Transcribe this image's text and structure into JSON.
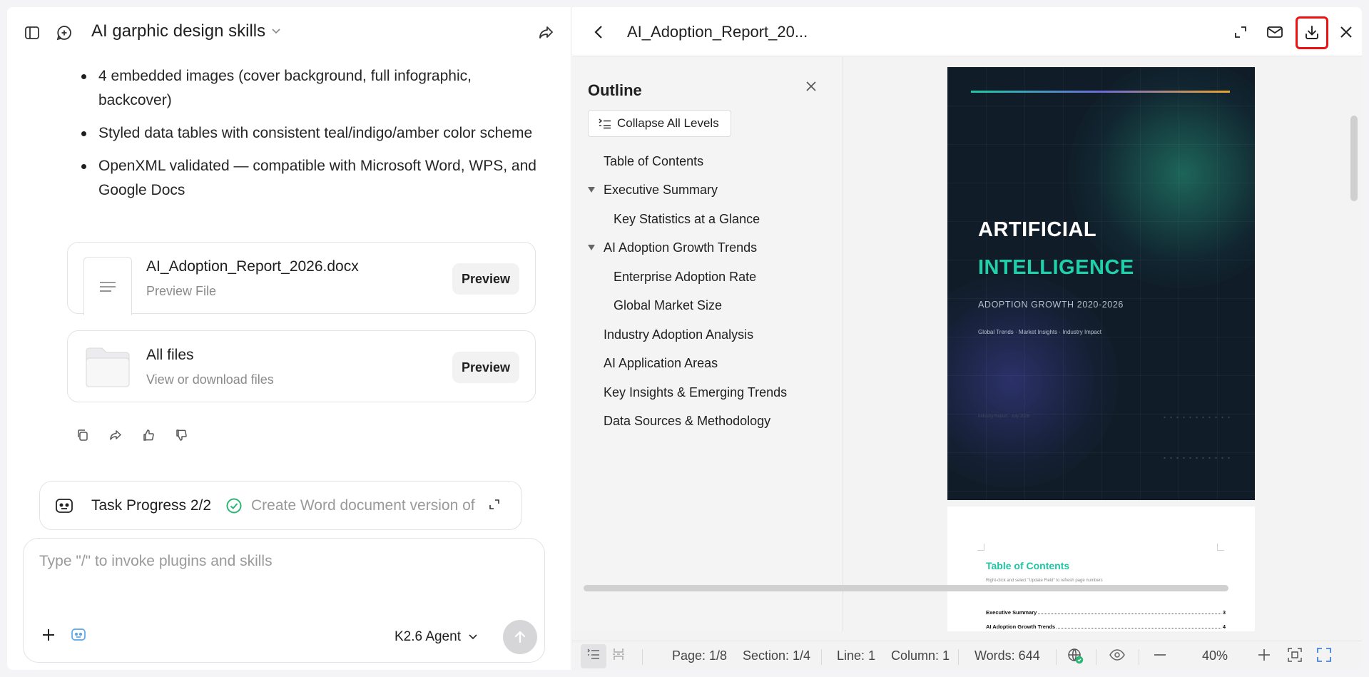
{
  "left": {
    "title": "AI garphic design skills",
    "bullets": [
      "4 embedded images (cover background, full infographic, backcover)",
      "Styled data tables with consistent teal/indigo/amber color scheme",
      "OpenXML validated — compatible with Microsoft Word, WPS, and Google Docs"
    ],
    "file_card": {
      "name": "AI_Adoption_Report_2026.docx",
      "sub": "Preview File",
      "button": "Preview"
    },
    "folder_card": {
      "name": "All files",
      "sub": "View or download files",
      "button": "Preview"
    },
    "task": {
      "label": "Task Progress 2/2",
      "text": "Create Word document version of"
    },
    "composer": {
      "placeholder": "Type \"/\" to invoke plugins and skills",
      "model": "K2.6 Agent"
    }
  },
  "right": {
    "doc_title": "AI_Adoption_Report_20...",
    "outline": {
      "title": "Outline",
      "collapse_label": "Collapse All Levels",
      "items": [
        {
          "label": "Table of Contents"
        },
        {
          "label": "Executive Summary"
        },
        {
          "label": "Key Statistics at a Glance"
        },
        {
          "label": "AI Adoption Growth Trends"
        },
        {
          "label": "Enterprise Adoption Rate"
        },
        {
          "label": "Global Market Size"
        },
        {
          "label": "Industry Adoption Analysis"
        },
        {
          "label": "AI Application Areas"
        },
        {
          "label": "Key Insights & Emerging Trends"
        },
        {
          "label": "Data Sources & Methodology"
        }
      ]
    },
    "cover": {
      "line1": "ARTIFICIAL",
      "line2": "INTELLIGENCE",
      "line3": "ADOPTION GROWTH 2020-2026",
      "line4": "Global Trends · Market Insights · Industry Impact",
      "footer": "Industry Report · July 2026"
    },
    "toc_page": {
      "heading": "Table of Contents",
      "hint": "Right-click and select \"Update Field\" to refresh page numbers",
      "rows": [
        {
          "label": "Executive Summary",
          "page": "3"
        },
        {
          "label": "AI Adoption Growth Trends",
          "page": "4"
        }
      ]
    },
    "status": {
      "page": "Page: 1/8",
      "section": "Section: 1/4",
      "line": "Line: 1",
      "column": "Column: 1",
      "words": "Words: 644",
      "zoom": "40%"
    }
  }
}
